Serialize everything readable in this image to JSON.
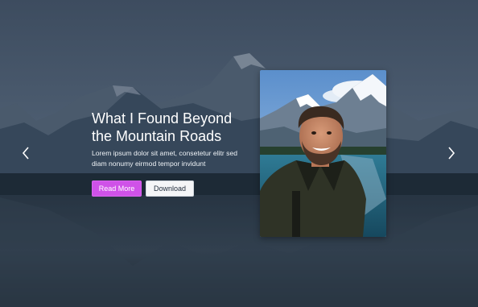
{
  "hero": {
    "title": "What I Found Beyond the Mountain Roads",
    "description": "Lorem ipsum dolor sit amet, consetetur elitr sed diam nonumy eirmod tempor invidunt",
    "primary_button": "Read More",
    "secondary_button": "Download"
  },
  "icons": {
    "prev": "chevron-left-icon",
    "next": "chevron-right-icon"
  },
  "colors": {
    "primary_button": "#cf52e8",
    "secondary_button": "#f4f5f7",
    "overlay": "#1e2c3c"
  }
}
